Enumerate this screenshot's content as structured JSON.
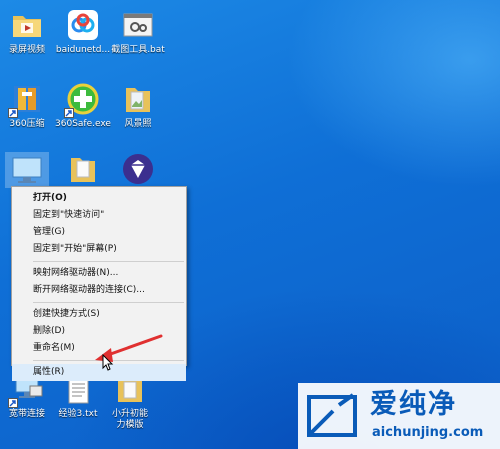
{
  "desktop_icons": [
    {
      "label": "录屏视频",
      "icon": "folder-video-icon"
    },
    {
      "label": "baidunetd...",
      "icon": "baidunetdisk-icon"
    },
    {
      "label": "截图工具.bat",
      "icon": "bat-file-icon"
    },
    {
      "label": "360压缩",
      "icon": "360zip-icon"
    },
    {
      "label": "360Safe.exe",
      "icon": "360safe-icon"
    },
    {
      "label": "风景照",
      "icon": "folder-photos-icon"
    },
    {
      "label": "宽带连接",
      "icon": "broadband-connection-icon"
    },
    {
      "label": "经验3.txt",
      "icon": "txt-file-icon"
    },
    {
      "label": "小升初能力模版",
      "icon": "folder-template-icon"
    }
  ],
  "context_menu": {
    "items": [
      {
        "label": "打开(O)",
        "bold": true
      },
      {
        "label": "固定到\"快速访问\""
      },
      {
        "label": "管理(G)"
      },
      {
        "label": "固定到\"开始\"屏幕(P)"
      },
      {
        "label": "映射网络驱动器(N)..."
      },
      {
        "label": "断开网络驱动器的连接(C)..."
      },
      {
        "label": "创建快捷方式(S)"
      },
      {
        "label": "删除(D)"
      },
      {
        "label": "重命名(M)"
      },
      {
        "label": "属性(R)",
        "highlighted": true
      }
    ]
  },
  "watermark": {
    "brand_cn": "爱纯净",
    "url": "aichunjing.com"
  },
  "colors": {
    "desktop_bg": "#0f6fd6",
    "arrow": "#e03030",
    "watermark_text": "#0a5bb8"
  }
}
